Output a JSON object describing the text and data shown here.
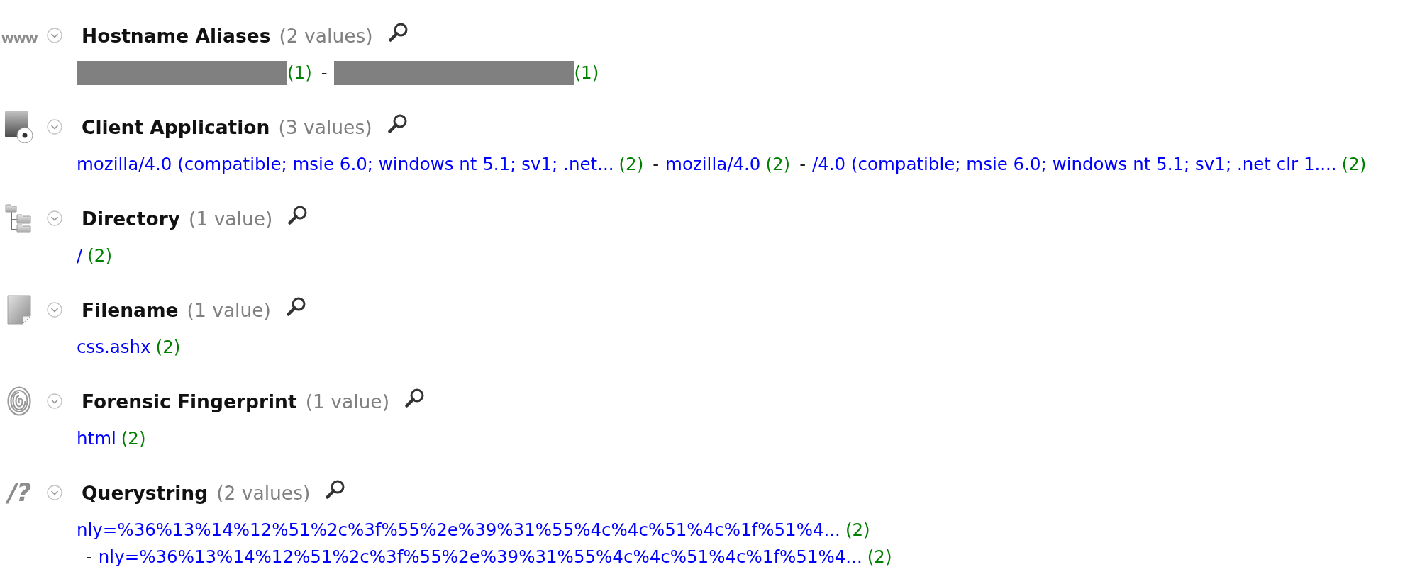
{
  "sections": [
    {
      "icon": {
        "kind": "text",
        "glyph": "www"
      },
      "title": "Hostname Aliases",
      "count": "(2 values)",
      "values": [
        {
          "kind": "redacted",
          "count": "(1)"
        },
        {
          "kind": "redacted",
          "separator": "-",
          "count": "(1)"
        }
      ]
    },
    {
      "icon": {
        "kind": "disc"
      },
      "title": "Client Application",
      "count": "(3 values)",
      "values": [
        {
          "kind": "link",
          "text": "mozilla/4.0 (compatible; msie 6.0; windows nt 5.1; sv1; .net...",
          "count": "(2)"
        },
        {
          "kind": "link",
          "separator": "-",
          "text": "mozilla/4.0",
          "count": "(2)"
        },
        {
          "kind": "link",
          "separator": "-",
          "text": "/4.0 (compatible; msie 6.0; windows nt 5.1; sv1; .net clr 1....",
          "count": "(2)"
        }
      ]
    },
    {
      "icon": {
        "kind": "tree"
      },
      "title": "Directory",
      "count": "(1 value)",
      "values": [
        {
          "kind": "link",
          "text": "/",
          "count": "(2)"
        }
      ]
    },
    {
      "icon": {
        "kind": "file"
      },
      "title": "Filename",
      "count": "(1 value)",
      "values": [
        {
          "kind": "link",
          "text": "css.ashx",
          "count": "(2)"
        }
      ]
    },
    {
      "icon": {
        "kind": "fingerprint"
      },
      "title": "Forensic Fingerprint",
      "count": "(1 value)",
      "values": [
        {
          "kind": "link",
          "text": "html",
          "count": "(2)"
        }
      ]
    },
    {
      "icon": {
        "kind": "text",
        "glyph": "/?"
      },
      "title": "Querystring",
      "count": "(2 values)",
      "values": [
        {
          "kind": "link",
          "text": "nly=%36%13%14%12%51%2c%3f%55%2e%39%31%55%4c%4c%51%4c%1f%51%4...",
          "count": "(2)"
        },
        {
          "kind": "link",
          "separator": "-",
          "text": "nly=%36%13%14%12%51%2c%3f%55%2e%39%31%55%4c%4c%51%4c%1f%51%4...",
          "count": "(2)"
        }
      ]
    }
  ]
}
